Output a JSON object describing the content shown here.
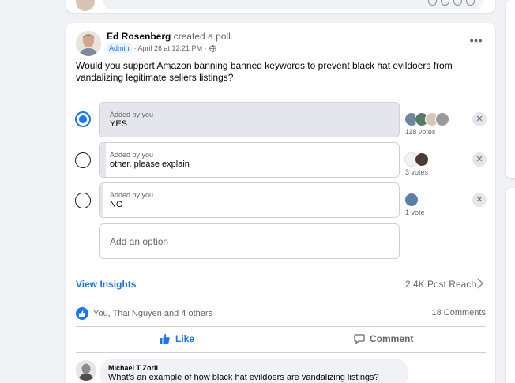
{
  "post": {
    "author": "Ed Rosenberg",
    "action": "created a poll.",
    "badge": "Admin",
    "timestamp": "· April 26 at 12:21 PM ·",
    "question": "Would you support Amazon banning banned keywords to prevent black hat evildoers from vandalizing legitimate sellers listings?"
  },
  "poll": {
    "options": [
      {
        "added_by": "Added by you",
        "label": "YES",
        "votes": "118 votes",
        "selected": true,
        "share": 0.97
      },
      {
        "added_by": "Added by you",
        "label": "other. please explain",
        "votes": "3 votes",
        "selected": false,
        "share": 0.02
      },
      {
        "added_by": "Added by you",
        "label": "NO",
        "votes": "1 vote",
        "selected": false,
        "share": 0.01
      }
    ],
    "add_option_placeholder": "Add an option",
    "remove_glyph": "✕"
  },
  "insights": {
    "view_label": "View Insights",
    "reach": "2.4K Post Reach"
  },
  "engagement": {
    "reactions_text": "You, Thai Nguyen and 4 others",
    "comments_count": "18 Comments",
    "like_label": "Like",
    "comment_label": "Comment"
  },
  "comment": {
    "author": "Michael T Zoril",
    "text": "What's an example of how black hat evildoers are vandalizing listings?"
  },
  "colors": {
    "accent": "#1877f2",
    "link": "#1b74e4",
    "secondary_text": "#65676b"
  }
}
